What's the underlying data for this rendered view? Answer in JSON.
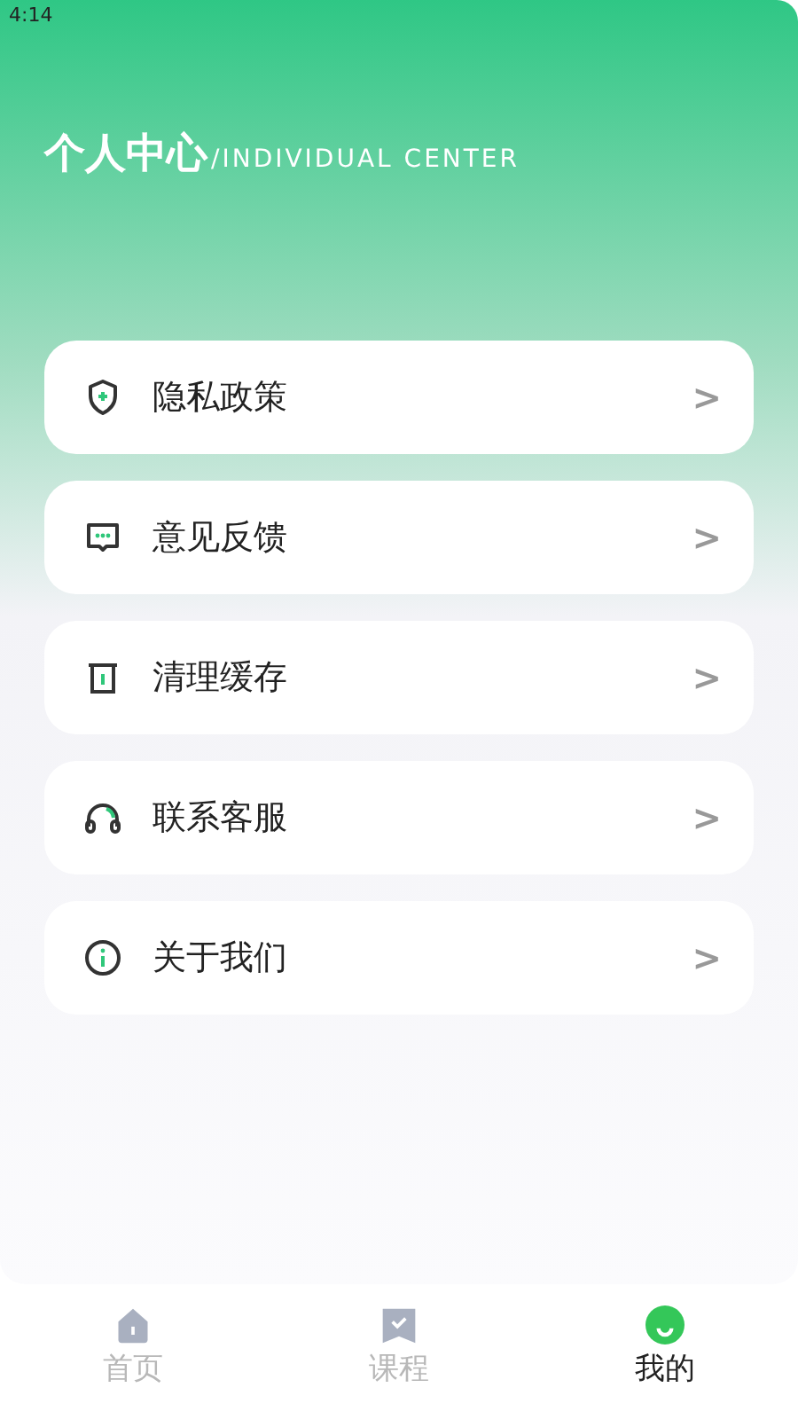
{
  "status_bar": {
    "time": "4:14"
  },
  "header": {
    "title": "个人中心",
    "subtitle": "/INDIVIDUAL CENTER"
  },
  "menu": [
    {
      "kind": "shield",
      "label": "隐私政策",
      "chevron": ">"
    },
    {
      "kind": "message",
      "label": "意见反馈",
      "chevron": ">"
    },
    {
      "kind": "trash",
      "label": "清理缓存",
      "chevron": ">"
    },
    {
      "kind": "headset",
      "label": "联系客服",
      "chevron": ">"
    },
    {
      "kind": "info",
      "label": "关于我们",
      "chevron": ">"
    }
  ],
  "tabs": [
    {
      "kind": "home",
      "label": "首页",
      "selected": false
    },
    {
      "kind": "course",
      "label": "课程",
      "selected": false
    },
    {
      "kind": "me",
      "label": "我的",
      "selected": true
    }
  ]
}
